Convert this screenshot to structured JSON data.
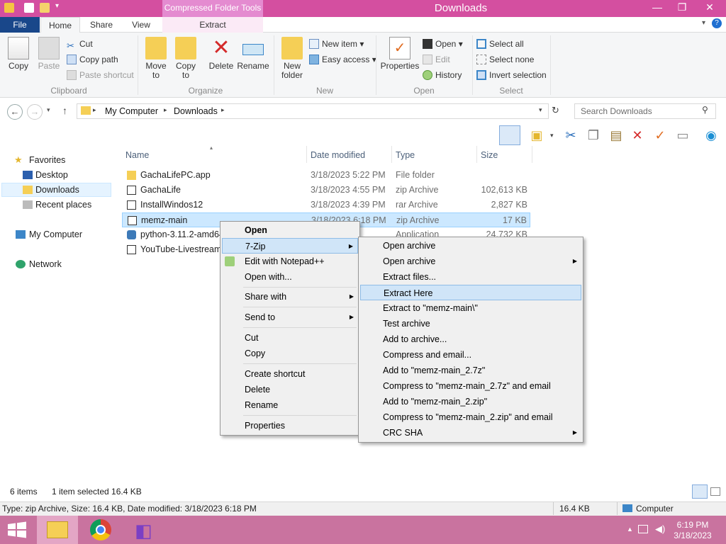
{
  "window": {
    "title": "Downloads",
    "contextual_tab": "Compressed Folder Tools",
    "minimize": "—",
    "maximize": "❐",
    "close": "✕"
  },
  "ribbon_tabs": [
    {
      "label": "File"
    },
    {
      "label": "Home"
    },
    {
      "label": "Share"
    },
    {
      "label": "View"
    },
    {
      "label": "Extract"
    }
  ],
  "ribbon": {
    "clipboard": {
      "label": "Clipboard",
      "copy": "Copy",
      "paste": "Paste",
      "cut": "Cut",
      "copy_path": "Copy path",
      "paste_shortcut": "Paste shortcut"
    },
    "organize": {
      "label": "Organize",
      "move_to": "Move to",
      "copy_to": "Copy to",
      "delete": "Delete",
      "rename": "Rename"
    },
    "new": {
      "label": "New",
      "new_folder": "New folder",
      "new_item": "New item",
      "easy_access": "Easy access"
    },
    "open": {
      "label": "Open",
      "properties": "Properties",
      "open": "Open",
      "edit": "Edit",
      "history": "History"
    },
    "select": {
      "label": "Select",
      "select_all": "Select all",
      "select_none": "Select none",
      "invert_selection": "Invert selection"
    }
  },
  "address": {
    "crumbs": [
      "My Computer",
      "Downloads"
    ],
    "search_placeholder": "Search Downloads"
  },
  "nav_pane": {
    "favorites": "Favorites",
    "items": [
      "Desktop",
      "Downloads",
      "Recent places"
    ],
    "my_computer": "My Computer",
    "network": "Network"
  },
  "columns": {
    "name": "Name",
    "date": "Date modified",
    "type": "Type",
    "size": "Size"
  },
  "files": [
    {
      "name": "GachaLifePC.app",
      "date": "3/18/2023 5:22 PM",
      "type": "File folder",
      "size": ""
    },
    {
      "name": "GachaLife",
      "date": "3/18/2023 4:55 PM",
      "type": "zip Archive",
      "size": "102,613 KB"
    },
    {
      "name": "InstallWindos12",
      "date": "3/18/2023 4:39 PM",
      "type": "rar Archive",
      "size": "2,827 KB"
    },
    {
      "name": "memz-main",
      "date": "3/18/2023 6:18 PM",
      "type": "zip Archive",
      "size": "17 KB"
    },
    {
      "name": "python-3.11.2-amd64",
      "date": "",
      "type": "Application",
      "size": "24,732 KB"
    },
    {
      "name": "YouTube-Livestream",
      "date": "",
      "type": "",
      "size": ""
    }
  ],
  "context_menu": [
    "Open",
    "7-Zip",
    "Edit with Notepad++",
    "Open with...",
    "Share with",
    "Send to",
    "Cut",
    "Copy",
    "Create shortcut",
    "Delete",
    "Rename",
    "Properties"
  ],
  "zip_submenu": [
    "Open archive",
    "Open archive",
    "Extract files...",
    "Extract Here",
    "Extract to \"memz-main\\\"",
    "Test archive",
    "Add to archive...",
    "Compress and email...",
    "Add to \"memz-main_2.7z\"",
    "Compress to \"memz-main_2.7z\" and email",
    "Add to \"memz-main_2.zip\"",
    "Compress to \"memz-main_2.zip\" and email",
    "CRC SHA"
  ],
  "status": {
    "items": "6 items",
    "selected": "1 item selected  16.4 KB",
    "info": "Type: zip Archive, Size: 16.4 KB, Date modified: 3/18/2023 6:18 PM",
    "info_size": "16.4 KB",
    "computer": "Computer"
  },
  "taskbar": {
    "time": "6:19 PM",
    "date": "3/18/2023"
  },
  "colors": {
    "title_bar": "#d44fa0",
    "file_tab": "#19478a",
    "taskbar": "#c9739f",
    "selection": "#cce8ff"
  }
}
